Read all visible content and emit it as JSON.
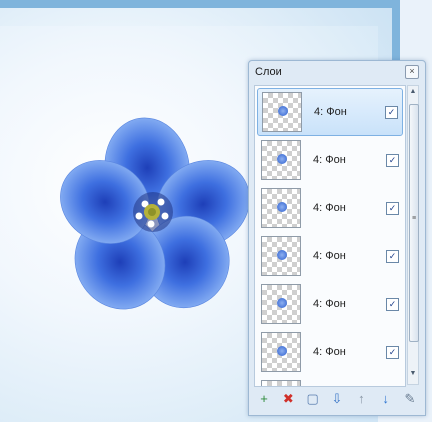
{
  "panel": {
    "title": "Слои",
    "close_glyph": "×"
  },
  "layers": [
    {
      "name": "4: Фон",
      "visible": true,
      "selected": true
    },
    {
      "name": "4: Фон",
      "visible": true,
      "selected": false
    },
    {
      "name": "4: Фон",
      "visible": true,
      "selected": false
    },
    {
      "name": "4: Фон",
      "visible": true,
      "selected": false
    },
    {
      "name": "4: Фон",
      "visible": true,
      "selected": false
    },
    {
      "name": "4: Фон",
      "visible": true,
      "selected": false
    }
  ],
  "checkbox_glyph": "✓",
  "toolbar": {
    "icons": [
      "add-layer-icon",
      "delete-layer-icon",
      "duplicate-layer-icon",
      "merge-down-icon",
      "move-up-icon",
      "move-down-icon",
      "properties-icon"
    ],
    "glyphs": [
      "+",
      "✖",
      "▢",
      "⇩",
      "↑",
      "↓",
      "✎"
    ]
  },
  "colors": {
    "accent": "#3f6fd6",
    "frame": "#7fb4dc",
    "delete": "#d0302a"
  }
}
